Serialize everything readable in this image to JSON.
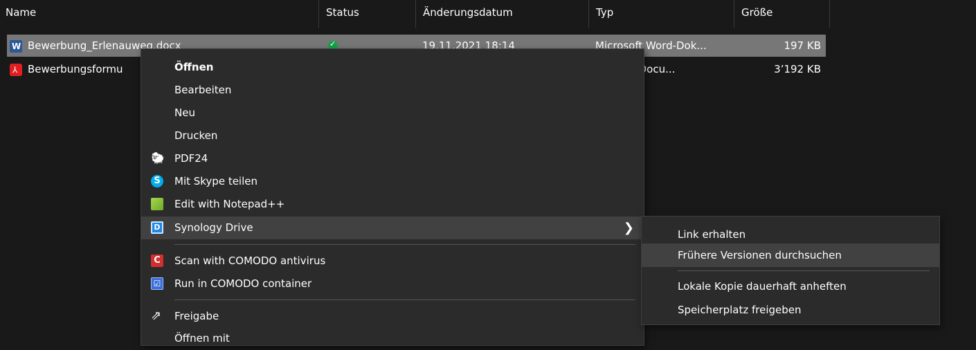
{
  "columns": {
    "name": "Name",
    "status": "Status",
    "date": "Änderungsdatum",
    "type": "Typ",
    "size": "Größe"
  },
  "files": [
    {
      "name": "Bewerbung_Erlenauweg.docx",
      "status": "synced",
      "date": "19.11.2021 18:14",
      "type": "Microsoft Word-Dok...",
      "size": "197 KB",
      "icon": "word-icon"
    },
    {
      "name": "Bewerbungsformu",
      "status": "",
      "date": "",
      "type": "Acrobat Docu...",
      "size": "3’192 KB",
      "icon": "pdf-icon"
    }
  ],
  "context_menu": {
    "open": "Öffnen",
    "edit": "Bearbeiten",
    "new": "Neu",
    "print": "Drucken",
    "pdf24": "PDF24",
    "skype": "Mit Skype teilen",
    "notepad": "Edit with Notepad++",
    "synology": "Synology Drive",
    "comodo_scan": "Scan with COMODO antivirus",
    "comodo_container": "Run in COMODO container",
    "share": "Freigabe",
    "open_with": "Öffnen mit"
  },
  "submenu": {
    "get_link": "Link erhalten",
    "browse_versions": "Frühere Versionen durchsuchen",
    "pin_local": "Lokale Kopie dauerhaft anheften",
    "free_space": "Speicherplatz freigeben"
  },
  "colors": {
    "background": "#191919",
    "selection": "#777777",
    "menu_bg": "#2b2b2b",
    "menu_hover": "#414141"
  }
}
